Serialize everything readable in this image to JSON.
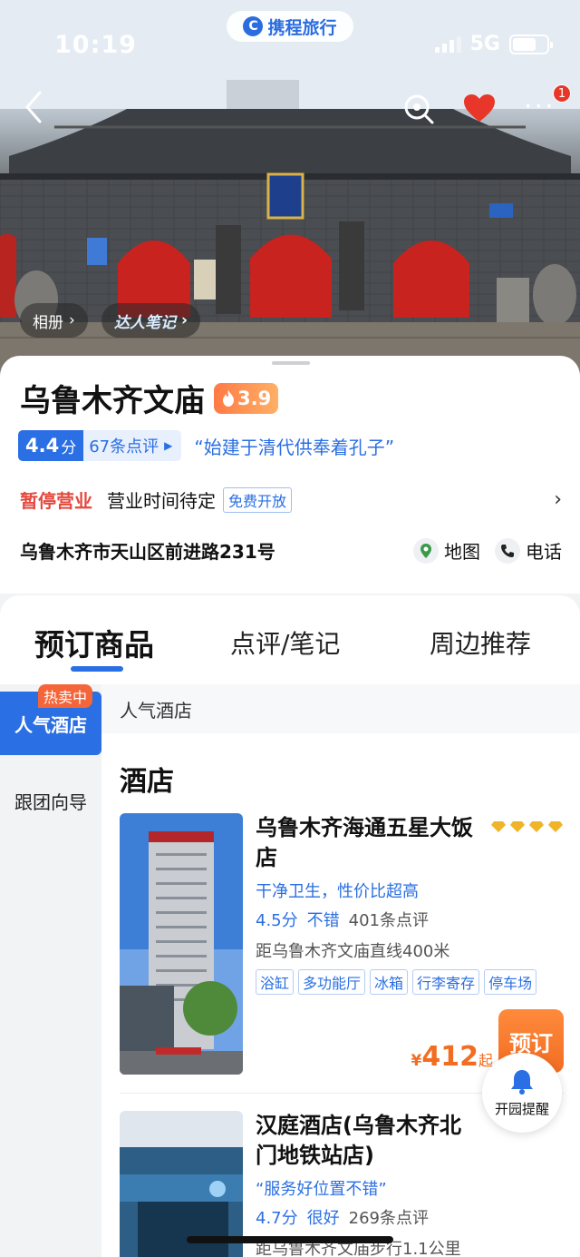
{
  "status": {
    "time": "10:19",
    "network": "5G"
  },
  "brand": {
    "name": "携程旅行"
  },
  "hero": {
    "album_label": "相册",
    "notes_label": "达人笔记",
    "notification_count": "1"
  },
  "attraction": {
    "name": "乌鲁木齐文庙",
    "hot_score": "3.9",
    "score": "4.4",
    "score_unit": "分",
    "reviews": "67条点评",
    "quote": "“始建于清代供奉着孔子”",
    "status": "暂停营业",
    "hours": "营业时间待定",
    "free_tag": "免费开放",
    "address": "乌鲁木齐市天山区前进路231号",
    "map_label": "地图",
    "phone_label": "电话"
  },
  "tabs": [
    "预订商品",
    "点评/笔记",
    "周边推荐"
  ],
  "sidebar": {
    "hot_badge": "热卖中",
    "items": [
      "人气酒店",
      "跟团向导"
    ]
  },
  "content": {
    "category_header": "人气酒店",
    "section_title": "酒店",
    "hotels": [
      {
        "name": "乌鲁木齐海通五星大饭店",
        "slogan": "干净卫生，性价比超高",
        "score": "4.5分",
        "score_word": "不错",
        "reviews": "401条点评",
        "distance": "距乌鲁木齐文庙直线400米",
        "tags": [
          "浴缸",
          "多功能厅",
          "冰箱",
          "行李寄存",
          "停车场"
        ],
        "price_symbol": "¥",
        "price": "412",
        "price_suffix": "起",
        "book_label": "预订"
      },
      {
        "name": "汉庭酒店(乌鲁木齐北门地铁站店)",
        "slogan": "“服务好位置不错”",
        "score": "4.7分",
        "score_word": "很好",
        "reviews": "269条点评",
        "distance": "距乌鲁木齐文庙步行1.1公里"
      }
    ]
  },
  "floating": {
    "remind_label": "开园提醒"
  },
  "colors": {
    "accent": "#2a6fe3",
    "price": "#f26d22",
    "closed": "#e5483e"
  }
}
